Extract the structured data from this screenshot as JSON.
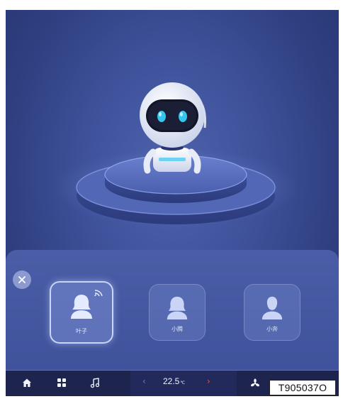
{
  "profiles": [
    {
      "name": "叶子",
      "avatar": "female-user-icon",
      "active": true,
      "badge": "voice-wave-icon"
    },
    {
      "name": "小腾",
      "avatar": "female-user-icon",
      "active": false
    },
    {
      "name": "小奔",
      "avatar": "male-user-icon",
      "active": false
    }
  ],
  "climate": {
    "temperature": "22.5",
    "unit": "℃",
    "decrease_icon": "chevron-left-icon",
    "increase_icon": "chevron-right-icon"
  },
  "dock": {
    "items": [
      "home-icon",
      "apps-grid-icon",
      "music-icon",
      "fan-icon"
    ]
  },
  "figure_code": "T905037O",
  "colors": {
    "accent_right_arrow": "#e5533d",
    "accent_left_arrow": "#5f7ad9",
    "robot_eyes": "#34c6ee"
  }
}
